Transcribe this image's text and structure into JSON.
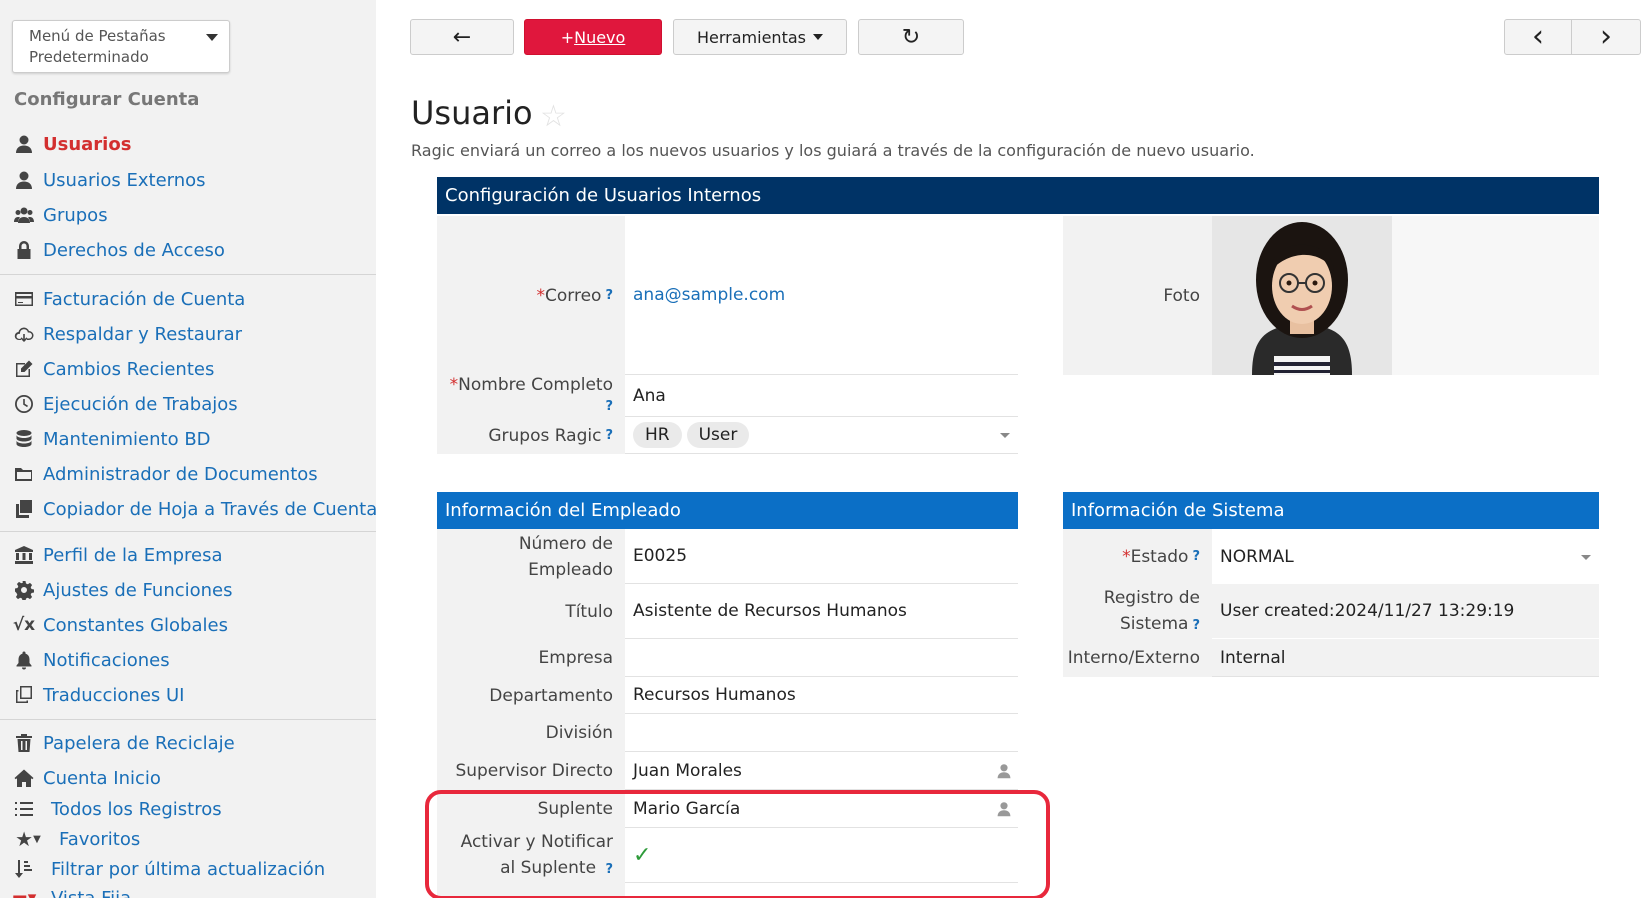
{
  "sidebar": {
    "menu_dropdown": "Menú de Pestañas Predeterminado",
    "section_title": "Configurar Cuenta",
    "items": [
      {
        "label": "Usuarios",
        "icon": "user-icon",
        "active": true
      },
      {
        "label": "Usuarios Externos",
        "icon": "user-icon"
      },
      {
        "label": "Grupos",
        "icon": "users-icon"
      },
      {
        "label": "Derechos de Acceso",
        "icon": "lock-icon"
      },
      {
        "label": "Facturación de Cuenta",
        "icon": "credit-card-icon"
      },
      {
        "label": "Respaldar y Restaurar",
        "icon": "cloud-download-icon"
      },
      {
        "label": "Cambios Recientes",
        "icon": "edit-icon"
      },
      {
        "label": "Ejecución de Trabajos",
        "icon": "clock-icon"
      },
      {
        "label": "Mantenimiento BD",
        "icon": "database-icon"
      },
      {
        "label": "Administrador de Documentos",
        "icon": "folder-icon"
      },
      {
        "label": "Copiador de Hoja a Través de Cuenta",
        "icon": "copy-sheets-icon"
      },
      {
        "label": "Perfil de la Empresa",
        "icon": "bank-icon"
      },
      {
        "label": "Ajustes de Funciones",
        "icon": "gear-icon"
      },
      {
        "label": "Constantes Globales",
        "icon": "sqrt-icon"
      },
      {
        "label": "Notificaciones",
        "icon": "bell-icon"
      },
      {
        "label": "Traducciones UI",
        "icon": "clone-icon"
      },
      {
        "label": "Papelera de Reciclaje",
        "icon": "trash-icon"
      },
      {
        "label": "Cuenta Inicio",
        "icon": "home-icon"
      },
      {
        "label": "Todos los Registros",
        "icon": "list-icon"
      },
      {
        "label": "Favoritos",
        "icon": "star-filter-icon"
      },
      {
        "label": "Filtrar por última actualización",
        "icon": "sort-icon"
      },
      {
        "label": "Vista Fija",
        "icon": "pin-icon"
      }
    ]
  },
  "toolbar": {
    "back": "←",
    "new_prefix": "+",
    "new_label": "Nuevo",
    "tools": "Herramientas",
    "refresh": "↻",
    "prev": "‹",
    "next": "›"
  },
  "page": {
    "title": "Usuario",
    "description": "Ragic enviará un correo a los nuevos usuarios y los guiará a través de la configuración de nuevo usuario."
  },
  "internal": {
    "header": "Configuración de Usuarios Internos",
    "email_label": "Correo",
    "email_value": "ana@sample.com",
    "photo_label": "Foto",
    "fullname_label": "Nombre Completo",
    "fullname_value": "Ana",
    "groups_label": "Grupos Ragic",
    "groups": [
      "HR",
      "User"
    ]
  },
  "employee": {
    "header": "Información del Empleado",
    "fields": [
      {
        "label": "Número de Empleado",
        "value": "E0025"
      },
      {
        "label": "Título",
        "value": "Asistente de Recursos Humanos"
      },
      {
        "label": "Empresa",
        "value": ""
      },
      {
        "label": "Departamento",
        "value": "Recursos Humanos"
      },
      {
        "label": "División",
        "value": ""
      },
      {
        "label": "Supervisor Directo",
        "value": "Juan Morales"
      },
      {
        "label": "Suplente",
        "value": "Mario García"
      },
      {
        "label": "Activar y Notificar al Suplente",
        "value": "✓"
      }
    ]
  },
  "system": {
    "header": "Información de Sistema",
    "status_label": "Estado",
    "status_value": "NORMAL",
    "log_label": "Registro de Sistema",
    "log_value": "User created:2024/11/27 13:29:19",
    "type_label": "Interno/Externo",
    "type_value": "Internal"
  },
  "required_mark": "*",
  "help_mark": "?"
}
